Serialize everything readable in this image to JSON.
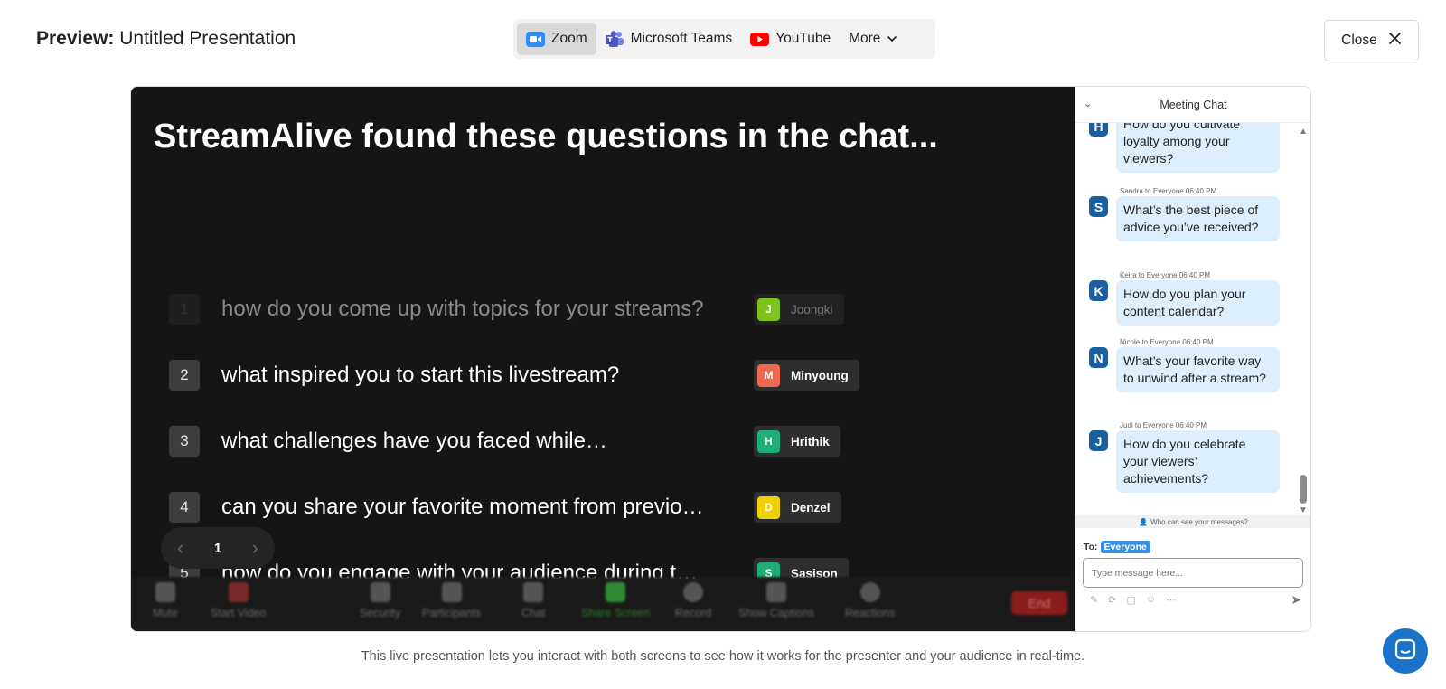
{
  "header": {
    "title_prefix": "Preview:",
    "title": "Untitled Presentation",
    "tabs": [
      {
        "label": "Zoom",
        "icon": "zoom-icon",
        "active": true
      },
      {
        "label": "Microsoft Teams",
        "icon": "teams-icon",
        "active": false
      },
      {
        "label": "YouTube",
        "icon": "youtube-icon",
        "active": false
      },
      {
        "label": "More",
        "icon": "chevron-down-icon",
        "active": false
      }
    ],
    "close_label": "Close"
  },
  "slide": {
    "title": "StreamAlive found these questions in the chat...",
    "questions": [
      {
        "num": "1",
        "text": "how do you come up with topics for your streams?",
        "author": "Joongki",
        "initial": "J",
        "color": "#7cc41d",
        "answered": true
      },
      {
        "num": "2",
        "text": "what inspired you to start this livestream?",
        "author": "Minyoung",
        "initial": "M",
        "color": "#f0684f",
        "answered": false
      },
      {
        "num": "3",
        "text": "what challenges have you faced while…",
        "author": "Hrithik",
        "initial": "H",
        "color": "#1fae78",
        "answered": false
      },
      {
        "num": "4",
        "text": "can you share your favorite moment from previo…",
        "author": "Denzel",
        "initial": "D",
        "color": "#f2d100",
        "answered": false
      },
      {
        "num": "5",
        "text": "how do you engage with your audience during t…",
        "author": "Sasison",
        "initial": "S",
        "color": "#1fae78",
        "answered": false
      }
    ],
    "page": "1"
  },
  "zoom_toolbar": {
    "items": [
      "Mute",
      "Start Video",
      "Security",
      "Participants",
      "Chat",
      "Share Screen",
      "Record",
      "Show Captions",
      "Reactions"
    ],
    "end_label": "End"
  },
  "chat": {
    "title": "Meeting Chat",
    "messages": [
      {
        "meta": "",
        "initial": "H",
        "text": "How do you cultivate loyalty among your viewers?"
      },
      {
        "meta": "Sandra to Everyone        06:40 PM",
        "initial": "S",
        "text": "What’s the best piece of advice you’ve received?"
      },
      {
        "meta": "Keira to Everyone        06:40 PM",
        "initial": "K",
        "text": "How do you plan your content calendar?"
      },
      {
        "meta": "Nicole to Everyone        06:40 PM",
        "initial": "N",
        "text": "What’s your favorite way to unwind after a stream?"
      },
      {
        "meta": "Judi to Everyone        06:40 PM",
        "initial": "J",
        "text": "How do you celebrate your viewers’ achievements?"
      }
    ],
    "who_can_see": "Who can see your messages?",
    "to_label": "To:",
    "recipient": "Everyone",
    "input_placeholder": "Type message here..."
  },
  "footnote": "This live presentation lets you interact with both screens to see how it works for the presenter and your audience in real-time."
}
